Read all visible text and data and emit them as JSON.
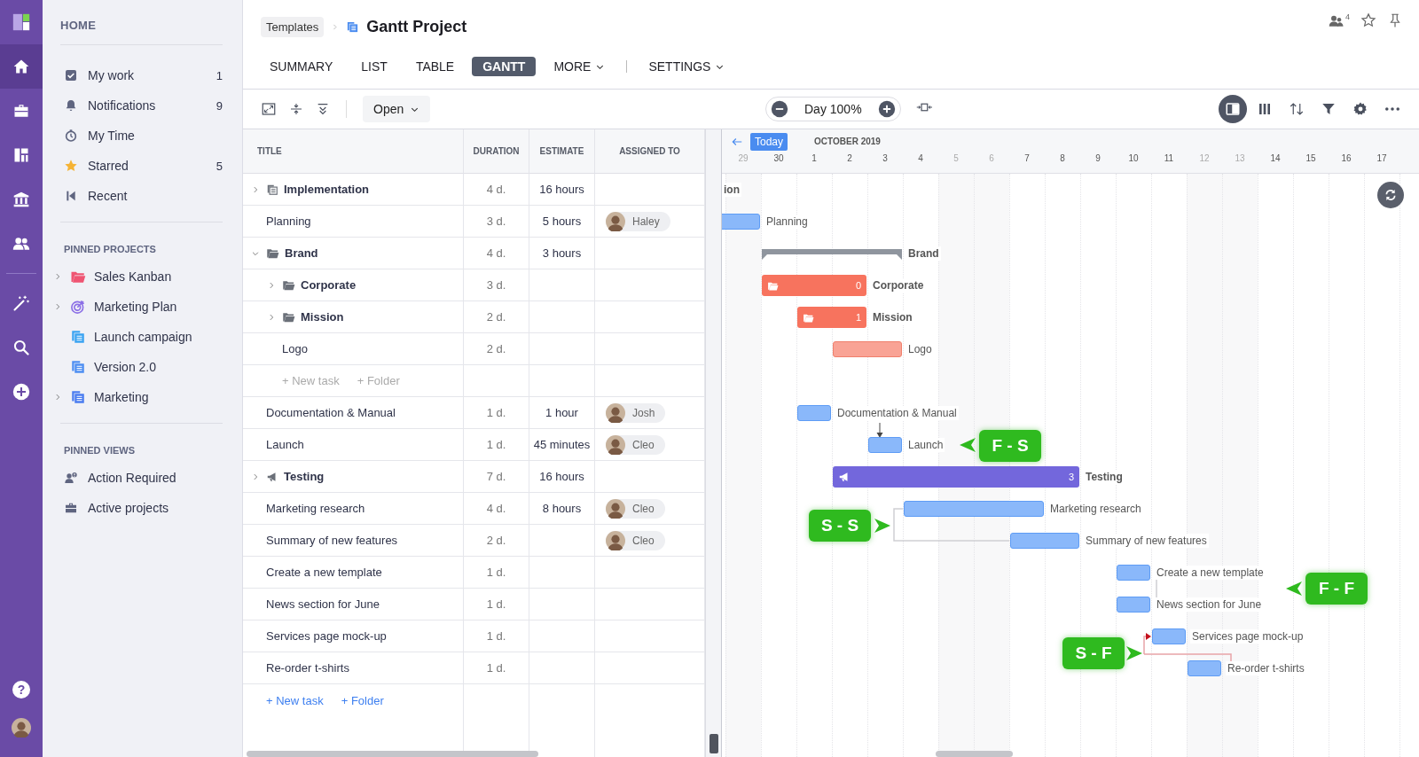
{
  "rail": {
    "items": [
      {
        "kind": "home",
        "selected": true
      },
      {
        "kind": "briefcase",
        "selected": false
      },
      {
        "kind": "board",
        "selected": false
      },
      {
        "kind": "bank",
        "selected": false
      },
      {
        "kind": "people",
        "selected": false
      },
      {
        "kind": "wand",
        "selected": false
      },
      {
        "kind": "search",
        "selected": false
      },
      {
        "kind": "add",
        "selected": false
      }
    ],
    "help": "?"
  },
  "sidebar": {
    "title": "HOME",
    "items": [
      {
        "label": "My work",
        "kind": "check",
        "count": "1"
      },
      {
        "label": "Notifications",
        "kind": "bell",
        "count": "9"
      },
      {
        "label": "My Time",
        "kind": "timer"
      },
      {
        "label": "Starred",
        "kind": "star",
        "count": "5"
      },
      {
        "label": "Recent",
        "kind": "recent"
      }
    ],
    "sections": [
      {
        "title": "PINNED PROJECTS",
        "items": [
          {
            "label": "Sales Kanban",
            "kind": "folder",
            "color": "#ef5472",
            "expandable": true
          },
          {
            "label": "Marketing Plan",
            "kind": "target",
            "color": "#8b6fe6",
            "expandable": true
          },
          {
            "label": "Launch campaign",
            "kind": "pages",
            "color": "#3aa3f2",
            "expandable": false
          },
          {
            "label": "Version 2.0",
            "kind": "pages",
            "color": "#4d8ef2",
            "expandable": false
          },
          {
            "label": "Marketing",
            "kind": "pages",
            "color": "#4a7cf0",
            "expandable": true
          }
        ]
      },
      {
        "title": "PINNED VIEWS",
        "items": [
          {
            "label": "Action Required",
            "kind": "user-alert"
          },
          {
            "label": "Active projects",
            "kind": "briefcase"
          }
        ]
      }
    ]
  },
  "breadcrumb": {
    "parent": "Templates",
    "title": "Gantt Project"
  },
  "header_actions": {
    "members_count": "4"
  },
  "tabs": [
    {
      "label": "SUMMARY",
      "selected": false
    },
    {
      "label": "LIST",
      "selected": false
    },
    {
      "label": "TABLE",
      "selected": false
    },
    {
      "label": "GANTT",
      "selected": true
    },
    {
      "label": "MORE",
      "selected": false,
      "menu": true
    },
    {
      "label": "SETTINGS",
      "selected": false,
      "menu": true,
      "separator_before": true
    }
  ],
  "toolbar": {
    "filter": "Open",
    "zoom": "Day 100%",
    "views": [
      {
        "kind": "split",
        "selected": true
      },
      {
        "kind": "columns",
        "selected": false
      },
      {
        "kind": "sort",
        "selected": false
      },
      {
        "kind": "filter",
        "selected": false
      },
      {
        "kind": "settings",
        "selected": false
      },
      {
        "kind": "more",
        "selected": false
      }
    ]
  },
  "table": {
    "columns": [
      "TITLE",
      "DURATION",
      "ESTIMATE",
      "ASSIGNED TO"
    ],
    "rows": [
      {
        "kind": "project",
        "title": "Implementation",
        "expanded": false,
        "duration": "4 d.",
        "estimate": "16 hours"
      },
      {
        "kind": "task",
        "title": "Planning",
        "duration": "3 d.",
        "estimate": "5 hours",
        "assignee": "Haley"
      },
      {
        "kind": "folder",
        "title": "Brand",
        "expanded": true,
        "duration": "4 d.",
        "estimate": "3 hours",
        "children": [
          {
            "kind": "folder",
            "title": "Corporate",
            "expanded": false,
            "duration": "3 d."
          },
          {
            "kind": "folder",
            "title": "Mission",
            "expanded": false,
            "duration": "2 d."
          },
          {
            "kind": "task",
            "title": "Logo",
            "duration": "2 d."
          },
          {
            "kind": "add",
            "task": "+ New task",
            "folder": "+ Folder"
          }
        ]
      },
      {
        "kind": "task",
        "title": "Documentation & Manual",
        "duration": "1 d.",
        "estimate": "1 hour",
        "assignee": "Josh"
      },
      {
        "kind": "task",
        "title": "Launch",
        "duration": "1 d.",
        "estimate": "45 minutes",
        "assignee": "Cleo"
      },
      {
        "kind": "milestone",
        "title": "Testing",
        "expanded": false,
        "duration": "7 d.",
        "estimate": "16 hours"
      },
      {
        "kind": "task",
        "title": "Marketing research",
        "duration": "4 d.",
        "estimate": "8 hours",
        "assignee": "Cleo"
      },
      {
        "kind": "task",
        "title": "Summary of new features",
        "duration": "2 d.",
        "assignee": "Cleo"
      },
      {
        "kind": "task",
        "title": "Create a new template",
        "duration": "1 d."
      },
      {
        "kind": "task",
        "title": "News section for June",
        "duration": "1 d."
      },
      {
        "kind": "task",
        "title": "Services page mock-up",
        "duration": "1 d."
      },
      {
        "kind": "task",
        "title": "Re-order t-shirts",
        "duration": "1 d."
      }
    ],
    "add": {
      "task": "+ New task",
      "folder": "+ Folder"
    }
  },
  "gantt": {
    "today": "Today",
    "month": "OCTOBER 2019",
    "days": [
      {
        "label": "29",
        "weekend": true
      },
      {
        "label": "30",
        "weekend": false
      },
      {
        "label": "1",
        "weekend": false
      },
      {
        "label": "2",
        "weekend": false
      },
      {
        "label": "3",
        "weekend": false
      },
      {
        "label": "4",
        "weekend": false
      },
      {
        "label": "5",
        "weekend": true
      },
      {
        "label": "6",
        "weekend": true
      },
      {
        "label": "7",
        "weekend": false
      },
      {
        "label": "8",
        "weekend": false
      },
      {
        "label": "9",
        "weekend": false
      },
      {
        "label": "10",
        "weekend": false
      },
      {
        "label": "11",
        "weekend": false
      },
      {
        "label": "12",
        "weekend": true
      },
      {
        "label": "13",
        "weekend": true
      },
      {
        "label": "14",
        "weekend": false
      },
      {
        "label": "15",
        "weekend": false
      },
      {
        "label": "16",
        "weekend": false
      },
      {
        "label": "17",
        "weekend": false
      }
    ],
    "bars": [
      {
        "kind": "offscreen",
        "label": "ion"
      },
      {
        "kind": "task",
        "label": "Planning"
      },
      {
        "kind": "bracket",
        "label": "Brand"
      },
      {
        "kind": "folder",
        "label": "Corporate",
        "count": "0"
      },
      {
        "kind": "folder",
        "label": "Mission",
        "count": "1"
      },
      {
        "kind": "light",
        "label": "Logo"
      },
      {
        "kind": "task",
        "label": "Documentation & Manual"
      },
      {
        "kind": "task",
        "label": "Launch"
      },
      {
        "kind": "milestone",
        "label": "Testing",
        "count": "3"
      },
      {
        "kind": "task",
        "label": "Marketing research"
      },
      {
        "kind": "task",
        "label": "Summary of new features"
      },
      {
        "kind": "task",
        "label": "Create a new template"
      },
      {
        "kind": "task",
        "label": "News section for June"
      },
      {
        "kind": "task",
        "label": "Services page mock-up"
      },
      {
        "kind": "task",
        "label": "Re-order t-shirts"
      }
    ],
    "links": [
      {
        "label": "F - S"
      },
      {
        "label": "S - S"
      },
      {
        "label": "F - F"
      },
      {
        "label": "S - F"
      }
    ]
  }
}
